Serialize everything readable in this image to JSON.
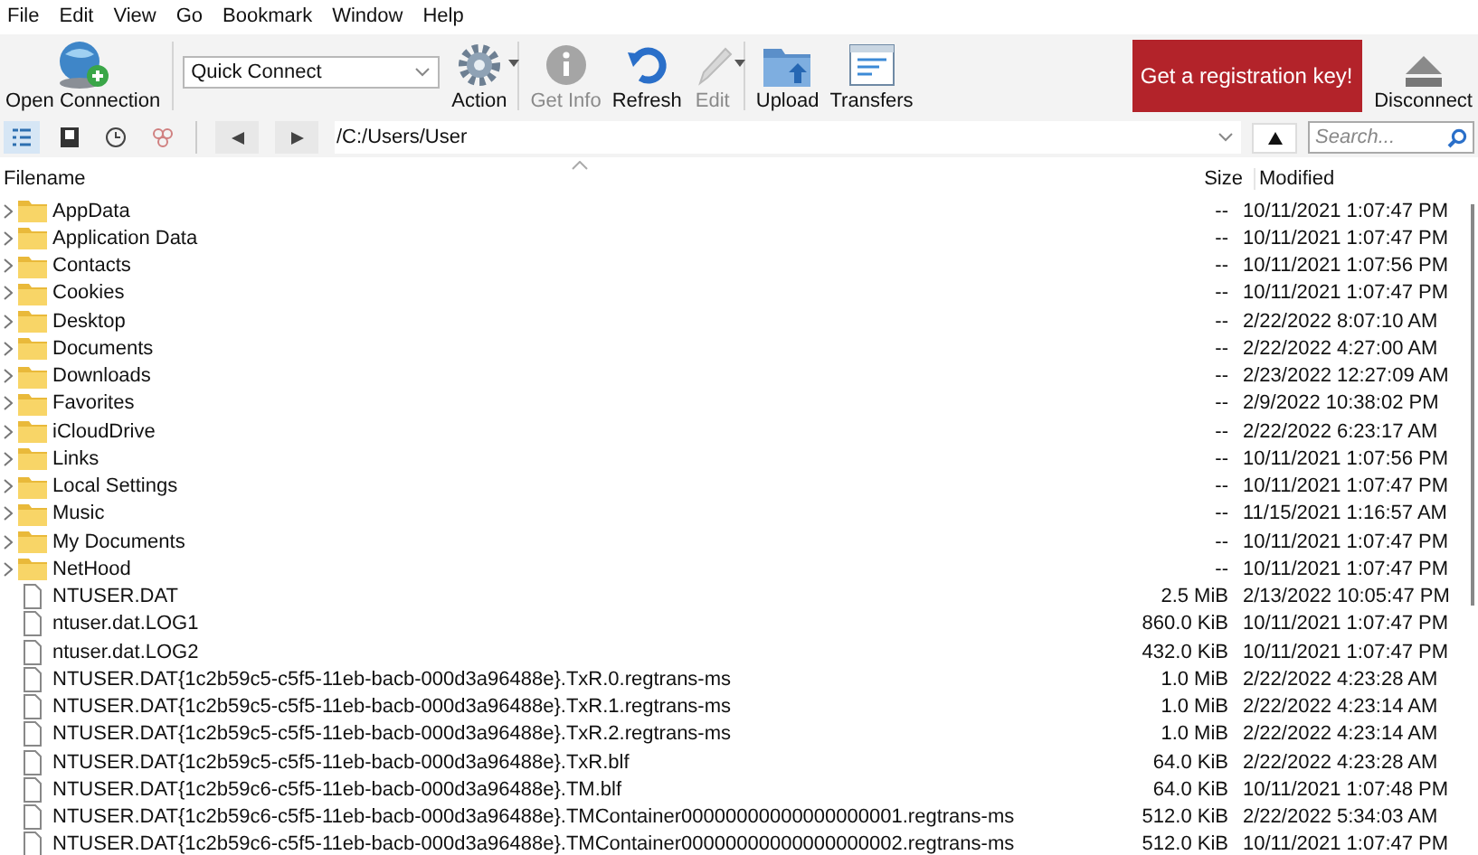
{
  "menu_bar": [
    "File",
    "Edit",
    "View",
    "Go",
    "Bookmark",
    "Window",
    "Help"
  ],
  "toolbar": {
    "open_connection": {
      "label": "Open Connection"
    },
    "quick_connect": {
      "value": "Quick Connect"
    },
    "buttons": [
      {
        "kind": "action",
        "label": "Action",
        "disabled": false,
        "dropdown": true
      },
      {
        "kind": "info",
        "label": "Get Info",
        "disabled": true,
        "dropdown": false
      },
      {
        "kind": "refresh",
        "label": "Refresh",
        "disabled": false,
        "dropdown": false
      },
      {
        "kind": "edit",
        "label": "Edit",
        "disabled": true,
        "dropdown": true
      },
      {
        "kind": "upload",
        "label": "Upload",
        "disabled": false,
        "dropdown": false
      },
      {
        "kind": "transfers",
        "label": "Transfers",
        "disabled": false,
        "dropdown": false
      }
    ],
    "registration": "Get a registration key!",
    "disconnect": {
      "label": "Disconnect"
    }
  },
  "navigation": {
    "views": [
      {
        "kind": "browser",
        "selected": true
      },
      {
        "kind": "bookmarks",
        "selected": false
      },
      {
        "kind": "history",
        "selected": false
      },
      {
        "kind": "bonjour",
        "selected": false
      }
    ],
    "path": "/C:/Users/User",
    "search": {
      "placeholder": "Search..."
    }
  },
  "table": {
    "columns": [
      "Filename",
      "Size",
      "Modified"
    ],
    "rows": [
      {
        "kind": "folder",
        "name": "AppData",
        "size": "--",
        "modified": "10/11/2021 1:07:47 PM"
      },
      {
        "kind": "folder",
        "name": "Application Data",
        "size": "--",
        "modified": "10/11/2021 1:07:47 PM"
      },
      {
        "kind": "folder",
        "name": "Contacts",
        "size": "--",
        "modified": "10/11/2021 1:07:56 PM"
      },
      {
        "kind": "folder",
        "name": "Cookies",
        "size": "--",
        "modified": "10/11/2021 1:07:47 PM"
      },
      {
        "kind": "folder",
        "name": "Desktop",
        "size": "--",
        "modified": "2/22/2022 8:07:10 AM"
      },
      {
        "kind": "folder",
        "name": "Documents",
        "size": "--",
        "modified": "2/22/2022 4:27:00 AM"
      },
      {
        "kind": "folder",
        "name": "Downloads",
        "size": "--",
        "modified": "2/23/2022 12:27:09 AM"
      },
      {
        "kind": "folder",
        "name": "Favorites",
        "size": "--",
        "modified": "2/9/2022 10:38:02 PM"
      },
      {
        "kind": "folder",
        "name": "iCloudDrive",
        "size": "--",
        "modified": "2/22/2022 6:23:17 AM"
      },
      {
        "kind": "folder",
        "name": "Links",
        "size": "--",
        "modified": "10/11/2021 1:07:56 PM"
      },
      {
        "kind": "folder",
        "name": "Local Settings",
        "size": "--",
        "modified": "10/11/2021 1:07:47 PM"
      },
      {
        "kind": "folder",
        "name": "Music",
        "size": "--",
        "modified": "11/15/2021 1:16:57 AM"
      },
      {
        "kind": "folder",
        "name": "My Documents",
        "size": "--",
        "modified": "10/11/2021 1:07:47 PM"
      },
      {
        "kind": "folder",
        "name": "NetHood",
        "size": "--",
        "modified": "10/11/2021 1:07:47 PM"
      },
      {
        "kind": "file",
        "name": "NTUSER.DAT",
        "size": "2.5 MiB",
        "modified": "2/13/2022 10:05:47 PM"
      },
      {
        "kind": "file",
        "name": "ntuser.dat.LOG1",
        "size": "860.0 KiB",
        "modified": "10/11/2021 1:07:47 PM"
      },
      {
        "kind": "file",
        "name": "ntuser.dat.LOG2",
        "size": "432.0 KiB",
        "modified": "10/11/2021 1:07:47 PM"
      },
      {
        "kind": "file",
        "name": "NTUSER.DAT{1c2b59c5-c5f5-11eb-bacb-000d3a96488e}.TxR.0.regtrans-ms",
        "size": "1.0 MiB",
        "modified": "2/22/2022 4:23:28 AM"
      },
      {
        "kind": "file",
        "name": "NTUSER.DAT{1c2b59c5-c5f5-11eb-bacb-000d3a96488e}.TxR.1.regtrans-ms",
        "size": "1.0 MiB",
        "modified": "2/22/2022 4:23:14 AM"
      },
      {
        "kind": "file",
        "name": "NTUSER.DAT{1c2b59c5-c5f5-11eb-bacb-000d3a96488e}.TxR.2.regtrans-ms",
        "size": "1.0 MiB",
        "modified": "2/22/2022 4:23:14 AM"
      },
      {
        "kind": "file",
        "name": "NTUSER.DAT{1c2b59c5-c5f5-11eb-bacb-000d3a96488e}.TxR.blf",
        "size": "64.0 KiB",
        "modified": "2/22/2022 4:23:28 AM"
      },
      {
        "kind": "file",
        "name": "NTUSER.DAT{1c2b59c6-c5f5-11eb-bacb-000d3a96488e}.TM.blf",
        "size": "64.0 KiB",
        "modified": "10/11/2021 1:07:48 PM"
      },
      {
        "kind": "file",
        "name": "NTUSER.DAT{1c2b59c6-c5f5-11eb-bacb-000d3a96488e}.TMContainer00000000000000000001.regtrans-ms",
        "size": "512.0 KiB",
        "modified": "2/22/2022 5:34:03 AM"
      },
      {
        "kind": "file",
        "name": "NTUSER.DAT{1c2b59c6-c5f5-11eb-bacb-000d3a96488e}.TMContainer00000000000000000002.regtrans-ms",
        "size": "512.0 KiB",
        "modified": "10/11/2021 1:07:47 PM"
      }
    ]
  }
}
